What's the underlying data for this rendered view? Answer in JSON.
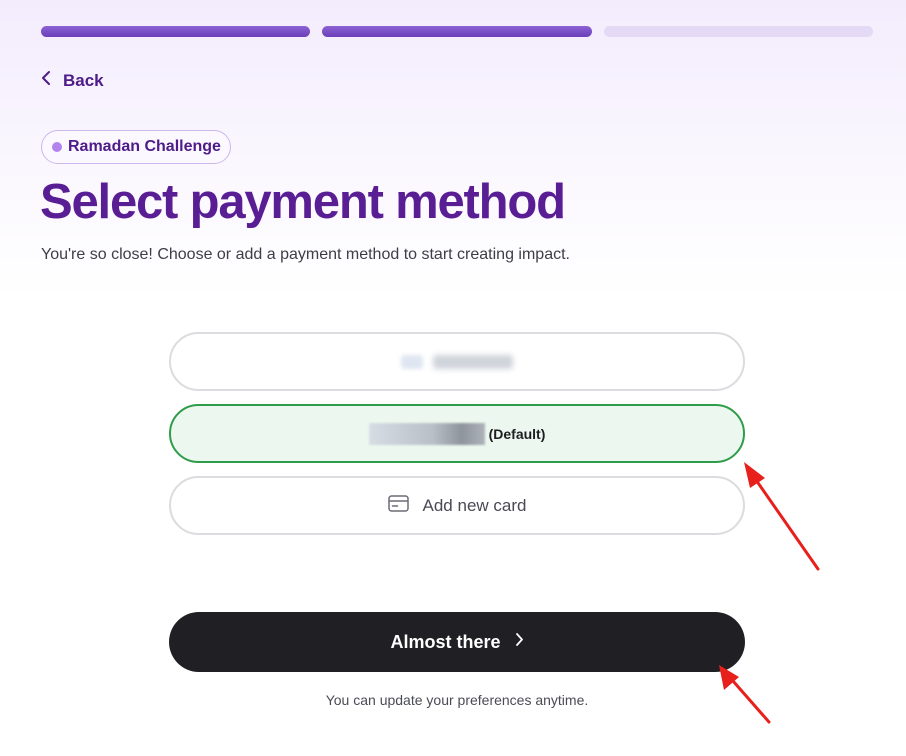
{
  "progress": {
    "total_steps": 3,
    "completed_steps": 2,
    "colors": {
      "done": "#7a4fc8",
      "todo": "#e4daf5"
    }
  },
  "nav": {
    "back_label": "Back",
    "back_icon": "chevron-left-icon"
  },
  "campaign": {
    "label": "Ramadan Challenge",
    "dot_color": "#b283ee"
  },
  "header": {
    "title": "Select payment method",
    "subtitle": "You're so close! Choose or add a payment method to start creating impact."
  },
  "payment_options": {
    "default_label": "(Default)",
    "add_card_label": "Add new card",
    "add_card_icon": "credit-card-icon",
    "selected_color": "#2f9c4a"
  },
  "cta": {
    "label": "Almost there",
    "icon": "chevron-right-icon"
  },
  "footer": {
    "note": "You can update your preferences anytime."
  },
  "annotation_color": "#e8201c"
}
